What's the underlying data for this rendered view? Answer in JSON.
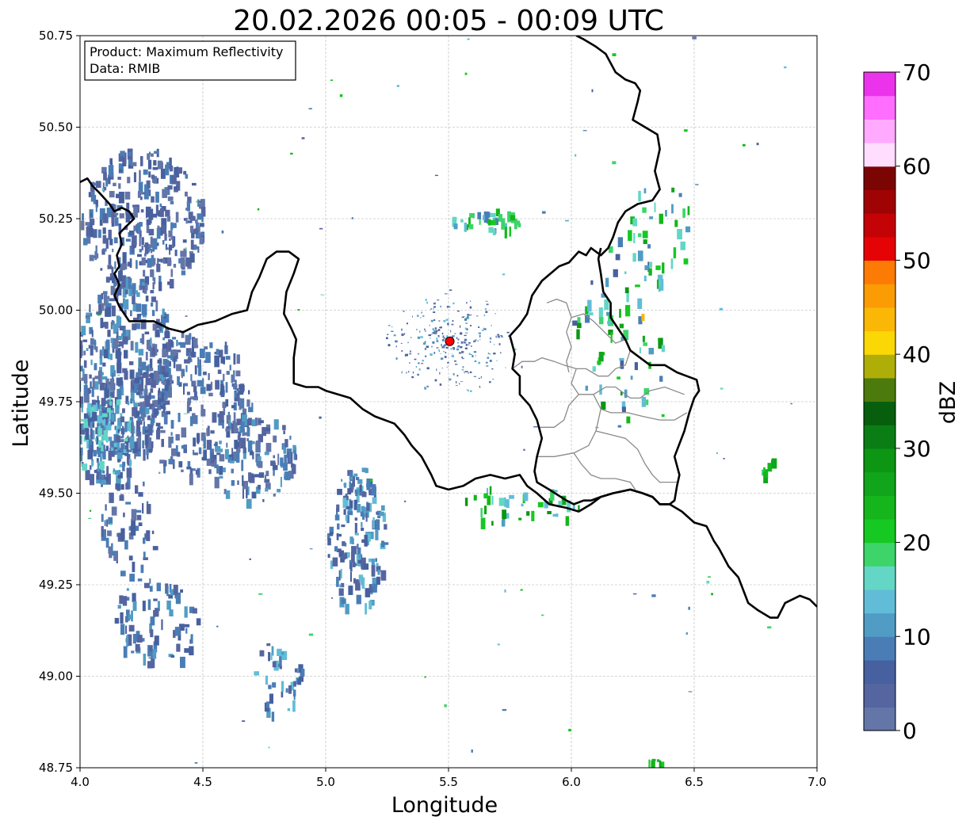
{
  "title": "20.02.2026 00:05 - 00:09 UTC",
  "info_box": {
    "line1": "Product: Maximum Reflectivity",
    "line2": "Data: RMIB"
  },
  "map_data": {
    "xlabel": "Longitude",
    "ylabel": "Latitude",
    "xlim": [
      4.0,
      7.0
    ],
    "ylim": [
      48.75,
      50.75
    ],
    "xticks": [
      "4.0",
      "4.5",
      "5.0",
      "5.5",
      "6.0",
      "6.5",
      "7.0"
    ],
    "yticks": [
      "48.75",
      "49.00",
      "49.25",
      "49.50",
      "49.75",
      "50.00",
      "50.25",
      "50.50",
      "50.75"
    ],
    "grid": true,
    "radar_site": {
      "lon": 5.505,
      "lat": 49.915,
      "color": "#ff0000"
    },
    "colorbar": {
      "label": "dBZ",
      "min": 0,
      "max": 70,
      "ticks": [
        "0",
        "10",
        "20",
        "30",
        "40",
        "50",
        "60",
        "70"
      ],
      "colors": [
        "#6476a8",
        "#5565a0",
        "#47609f",
        "#4a7db5",
        "#519cc4",
        "#61bdd7",
        "#63d6c5",
        "#3dd46a",
        "#16c822",
        "#14b61b",
        "#10a51a",
        "#0c9614",
        "#0a7e14",
        "#075e0c",
        "#4d7a0c",
        "#afae09",
        "#fbd705",
        "#fbb705",
        "#fb9c05",
        "#fb7b04",
        "#e50305",
        "#c30305",
        "#a00304",
        "#7b0503",
        "#ffddff",
        "#ffaaff",
        "#ff6eff",
        "#ec33ec"
      ]
    },
    "borders": [
      [
        [
          4.0,
          50.35
        ],
        [
          4.03,
          50.36
        ],
        [
          4.05,
          50.34
        ],
        [
          4.08,
          50.32
        ],
        [
          4.12,
          50.29
        ],
        [
          4.14,
          50.27
        ],
        [
          4.17,
          50.28
        ],
        [
          4.2,
          50.27
        ],
        [
          4.22,
          50.25
        ],
        [
          4.19,
          50.23
        ],
        [
          4.16,
          50.21
        ],
        [
          4.17,
          50.18
        ],
        [
          4.15,
          50.15
        ],
        [
          4.16,
          50.12
        ],
        [
          4.14,
          50.1
        ],
        [
          4.16,
          50.07
        ],
        [
          4.14,
          50.04
        ],
        [
          4.16,
          50.01
        ],
        [
          4.18,
          49.99
        ],
        [
          4.2,
          49.97
        ],
        [
          4.25,
          49.97
        ],
        [
          4.3,
          49.97
        ],
        [
          4.36,
          49.95
        ],
        [
          4.42,
          49.94
        ],
        [
          4.48,
          49.96
        ],
        [
          4.55,
          49.97
        ],
        [
          4.62,
          49.99
        ],
        [
          4.68,
          50.0
        ],
        [
          4.7,
          50.05
        ],
        [
          4.73,
          50.09
        ],
        [
          4.76,
          50.14
        ],
        [
          4.8,
          50.16
        ],
        [
          4.85,
          50.16
        ],
        [
          4.89,
          50.14
        ],
        [
          4.87,
          50.1
        ],
        [
          4.84,
          50.05
        ],
        [
          4.83,
          49.99
        ],
        [
          4.86,
          49.95
        ],
        [
          4.88,
          49.92
        ],
        [
          4.87,
          49.87
        ],
        [
          4.87,
          49.8
        ],
        [
          4.92,
          49.79
        ],
        [
          4.97,
          49.79
        ],
        [
          5.0,
          49.78
        ],
        [
          5.05,
          49.77
        ],
        [
          5.1,
          49.76
        ],
        [
          5.15,
          49.73
        ],
        [
          5.2,
          49.71
        ],
        [
          5.28,
          49.69
        ],
        [
          5.32,
          49.66
        ],
        [
          5.35,
          49.63
        ],
        [
          5.39,
          49.6
        ],
        [
          5.43,
          49.55
        ],
        [
          5.45,
          49.52
        ],
        [
          5.5,
          49.51
        ],
        [
          5.56,
          49.52
        ],
        [
          5.61,
          49.54
        ],
        [
          5.67,
          49.55
        ],
        [
          5.73,
          49.54
        ],
        [
          5.79,
          49.55
        ],
        [
          5.82,
          49.52
        ],
        [
          5.86,
          49.5
        ],
        [
          5.91,
          49.47
        ],
        [
          5.98,
          49.46
        ],
        [
          6.03,
          49.45
        ],
        [
          6.08,
          49.47
        ],
        [
          6.12,
          49.49
        ],
        [
          6.17,
          49.5
        ],
        [
          6.24,
          49.51
        ],
        [
          6.29,
          49.5
        ],
        [
          6.33,
          49.49
        ],
        [
          6.36,
          49.47
        ],
        [
          6.4,
          49.47
        ],
        [
          6.45,
          49.45
        ],
        [
          6.5,
          49.42
        ],
        [
          6.55,
          49.41
        ],
        [
          6.58,
          49.37
        ],
        [
          6.6,
          49.35
        ],
        [
          6.64,
          49.3
        ],
        [
          6.68,
          49.27
        ],
        [
          6.72,
          49.2
        ],
        [
          6.76,
          49.18
        ],
        [
          6.81,
          49.16
        ],
        [
          6.84,
          49.16
        ],
        [
          6.87,
          49.2
        ],
        [
          6.93,
          49.22
        ],
        [
          6.97,
          49.21
        ],
        [
          7.0,
          49.19
        ]
      ],
      [
        [
          6.02,
          50.75
        ],
        [
          6.05,
          50.74
        ],
        [
          6.1,
          50.72
        ],
        [
          6.14,
          50.7
        ],
        [
          6.18,
          50.65
        ],
        [
          6.22,
          50.63
        ],
        [
          6.26,
          50.62
        ],
        [
          6.28,
          50.6
        ],
        [
          6.27,
          50.57
        ],
        [
          6.25,
          50.52
        ],
        [
          6.3,
          50.5
        ],
        [
          6.35,
          50.48
        ],
        [
          6.36,
          50.44
        ],
        [
          6.34,
          50.38
        ],
        [
          6.36,
          50.33
        ],
        [
          6.33,
          50.3
        ],
        [
          6.27,
          50.29
        ],
        [
          6.22,
          50.27
        ],
        [
          6.19,
          50.24
        ],
        [
          6.17,
          50.2
        ],
        [
          6.15,
          50.17
        ],
        [
          6.12,
          50.15
        ],
        [
          6.08,
          50.17
        ],
        [
          6.06,
          50.15
        ],
        [
          6.03,
          50.16
        ],
        [
          5.99,
          50.13
        ],
        [
          5.95,
          50.12
        ],
        [
          5.88,
          50.08
        ],
        [
          5.84,
          50.04
        ],
        [
          5.82,
          49.99
        ],
        [
          5.79,
          49.96
        ],
        [
          5.75,
          49.93
        ],
        [
          5.77,
          49.88
        ],
        [
          5.76,
          49.84
        ],
        [
          5.79,
          49.82
        ],
        [
          5.79,
          49.77
        ],
        [
          5.83,
          49.74
        ],
        [
          5.86,
          49.7
        ],
        [
          5.88,
          49.65
        ],
        [
          5.86,
          49.6
        ],
        [
          5.85,
          49.56
        ],
        [
          5.86,
          49.53
        ],
        [
          5.91,
          49.51
        ],
        [
          5.98,
          49.48
        ],
        [
          6.01,
          49.47
        ],
        [
          6.05,
          49.48
        ],
        [
          6.08,
          49.48
        ],
        [
          6.12,
          49.49
        ],
        [
          6.17,
          49.5
        ],
        [
          6.24,
          49.51
        ],
        [
          6.29,
          49.5
        ],
        [
          6.33,
          49.49
        ],
        [
          6.36,
          49.47
        ],
        [
          6.4,
          49.47
        ],
        [
          6.42,
          49.48
        ],
        [
          6.43,
          49.52
        ],
        [
          6.44,
          49.55
        ],
        [
          6.42,
          49.6
        ],
        [
          6.46,
          49.67
        ],
        [
          6.48,
          49.72
        ],
        [
          6.5,
          49.76
        ],
        [
          6.52,
          49.78
        ],
        [
          6.51,
          49.81
        ],
        [
          6.47,
          49.82
        ],
        [
          6.43,
          49.83
        ],
        [
          6.38,
          49.85
        ],
        [
          6.32,
          49.85
        ],
        [
          6.28,
          49.87
        ],
        [
          6.24,
          49.89
        ],
        [
          6.22,
          49.92
        ],
        [
          6.19,
          49.95
        ],
        [
          6.16,
          49.98
        ],
        [
          6.16,
          50.02
        ],
        [
          6.13,
          50.05
        ],
        [
          6.12,
          50.1
        ],
        [
          6.11,
          50.14
        ],
        [
          6.12,
          50.17
        ]
      ]
    ],
    "admin_lines": [
      [
        [
          5.76,
          49.84
        ],
        [
          5.8,
          49.86
        ],
        [
          5.85,
          49.86
        ],
        [
          5.88,
          49.87
        ],
        [
          5.93,
          49.86
        ],
        [
          5.97,
          49.85
        ],
        [
          6.02,
          49.84
        ],
        [
          6.06,
          49.84
        ],
        [
          6.11,
          49.82
        ],
        [
          6.15,
          49.82
        ],
        [
          6.18,
          49.84
        ],
        [
          6.22,
          49.85
        ],
        [
          6.24,
          49.89
        ]
      ],
      [
        [
          5.9,
          50.02
        ],
        [
          5.94,
          50.03
        ],
        [
          5.98,
          50.02
        ],
        [
          6.0,
          49.98
        ],
        [
          5.98,
          49.94
        ],
        [
          6.0,
          49.9
        ],
        [
          5.98,
          49.86
        ],
        [
          5.99,
          49.83
        ]
      ],
      [
        [
          6.0,
          49.98
        ],
        [
          6.05,
          49.99
        ],
        [
          6.09,
          49.97
        ],
        [
          6.12,
          49.95
        ],
        [
          6.15,
          49.93
        ],
        [
          6.18,
          49.91
        ],
        [
          6.22,
          49.92
        ]
      ],
      [
        [
          6.02,
          49.84
        ],
        [
          6.0,
          49.8
        ],
        [
          6.03,
          49.77
        ],
        [
          6.09,
          49.77
        ],
        [
          6.14,
          49.79
        ],
        [
          6.18,
          49.79
        ],
        [
          6.24,
          49.76
        ],
        [
          6.28,
          49.76
        ],
        [
          6.32,
          49.78
        ],
        [
          6.38,
          49.79
        ],
        [
          6.46,
          49.77
        ]
      ],
      [
        [
          6.03,
          49.77
        ],
        [
          5.99,
          49.74
        ],
        [
          5.97,
          49.7
        ],
        [
          5.93,
          49.68
        ],
        [
          5.87,
          49.68
        ]
      ],
      [
        [
          6.09,
          49.77
        ],
        [
          6.12,
          49.73
        ],
        [
          6.16,
          49.72
        ],
        [
          6.23,
          49.72
        ],
        [
          6.29,
          49.71
        ],
        [
          6.36,
          49.7
        ],
        [
          6.42,
          49.7
        ],
        [
          6.47,
          49.72
        ]
      ],
      [
        [
          6.12,
          49.73
        ],
        [
          6.1,
          49.67
        ],
        [
          6.07,
          49.63
        ],
        [
          6.01,
          49.61
        ],
        [
          5.93,
          49.6
        ],
        [
          5.88,
          49.6
        ],
        [
          5.86,
          49.6
        ]
      ],
      [
        [
          6.1,
          49.67
        ],
        [
          6.16,
          49.66
        ],
        [
          6.22,
          49.65
        ],
        [
          6.27,
          49.62
        ],
        [
          6.3,
          49.58
        ],
        [
          6.33,
          49.55
        ],
        [
          6.36,
          49.53
        ],
        [
          6.43,
          49.53
        ]
      ],
      [
        [
          6.01,
          49.61
        ],
        [
          6.04,
          49.58
        ],
        [
          6.08,
          49.55
        ],
        [
          6.12,
          49.54
        ],
        [
          6.18,
          49.54
        ],
        [
          6.24,
          49.53
        ],
        [
          6.26,
          49.51
        ]
      ]
    ]
  }
}
